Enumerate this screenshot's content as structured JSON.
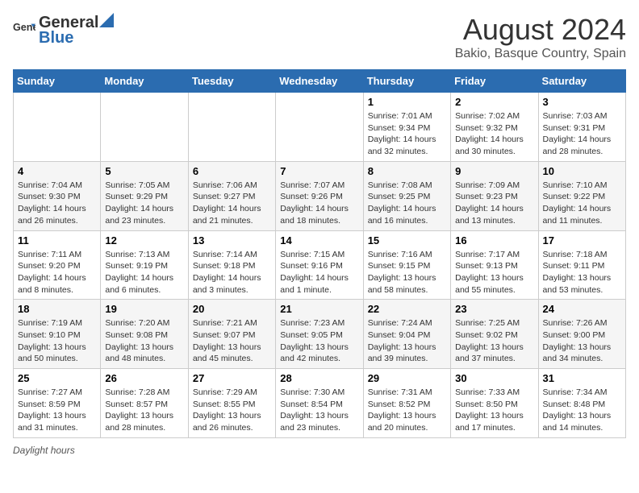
{
  "header": {
    "logo_general": "General",
    "logo_blue": "Blue",
    "title": "August 2024",
    "subtitle": "Bakio, Basque Country, Spain"
  },
  "weekdays": [
    "Sunday",
    "Monday",
    "Tuesday",
    "Wednesday",
    "Thursday",
    "Friday",
    "Saturday"
  ],
  "weeks": [
    [
      {
        "day": "",
        "info": ""
      },
      {
        "day": "",
        "info": ""
      },
      {
        "day": "",
        "info": ""
      },
      {
        "day": "",
        "info": ""
      },
      {
        "day": "1",
        "info": "Sunrise: 7:01 AM\nSunset: 9:34 PM\nDaylight: 14 hours\nand 32 minutes."
      },
      {
        "day": "2",
        "info": "Sunrise: 7:02 AM\nSunset: 9:32 PM\nDaylight: 14 hours\nand 30 minutes."
      },
      {
        "day": "3",
        "info": "Sunrise: 7:03 AM\nSunset: 9:31 PM\nDaylight: 14 hours\nand 28 minutes."
      }
    ],
    [
      {
        "day": "4",
        "info": "Sunrise: 7:04 AM\nSunset: 9:30 PM\nDaylight: 14 hours\nand 26 minutes."
      },
      {
        "day": "5",
        "info": "Sunrise: 7:05 AM\nSunset: 9:29 PM\nDaylight: 14 hours\nand 23 minutes."
      },
      {
        "day": "6",
        "info": "Sunrise: 7:06 AM\nSunset: 9:27 PM\nDaylight: 14 hours\nand 21 minutes."
      },
      {
        "day": "7",
        "info": "Sunrise: 7:07 AM\nSunset: 9:26 PM\nDaylight: 14 hours\nand 18 minutes."
      },
      {
        "day": "8",
        "info": "Sunrise: 7:08 AM\nSunset: 9:25 PM\nDaylight: 14 hours\nand 16 minutes."
      },
      {
        "day": "9",
        "info": "Sunrise: 7:09 AM\nSunset: 9:23 PM\nDaylight: 14 hours\nand 13 minutes."
      },
      {
        "day": "10",
        "info": "Sunrise: 7:10 AM\nSunset: 9:22 PM\nDaylight: 14 hours\nand 11 minutes."
      }
    ],
    [
      {
        "day": "11",
        "info": "Sunrise: 7:11 AM\nSunset: 9:20 PM\nDaylight: 14 hours\nand 8 minutes."
      },
      {
        "day": "12",
        "info": "Sunrise: 7:13 AM\nSunset: 9:19 PM\nDaylight: 14 hours\nand 6 minutes."
      },
      {
        "day": "13",
        "info": "Sunrise: 7:14 AM\nSunset: 9:18 PM\nDaylight: 14 hours\nand 3 minutes."
      },
      {
        "day": "14",
        "info": "Sunrise: 7:15 AM\nSunset: 9:16 PM\nDaylight: 14 hours\nand 1 minute."
      },
      {
        "day": "15",
        "info": "Sunrise: 7:16 AM\nSunset: 9:15 PM\nDaylight: 13 hours\nand 58 minutes."
      },
      {
        "day": "16",
        "info": "Sunrise: 7:17 AM\nSunset: 9:13 PM\nDaylight: 13 hours\nand 55 minutes."
      },
      {
        "day": "17",
        "info": "Sunrise: 7:18 AM\nSunset: 9:11 PM\nDaylight: 13 hours\nand 53 minutes."
      }
    ],
    [
      {
        "day": "18",
        "info": "Sunrise: 7:19 AM\nSunset: 9:10 PM\nDaylight: 13 hours\nand 50 minutes."
      },
      {
        "day": "19",
        "info": "Sunrise: 7:20 AM\nSunset: 9:08 PM\nDaylight: 13 hours\nand 48 minutes."
      },
      {
        "day": "20",
        "info": "Sunrise: 7:21 AM\nSunset: 9:07 PM\nDaylight: 13 hours\nand 45 minutes."
      },
      {
        "day": "21",
        "info": "Sunrise: 7:23 AM\nSunset: 9:05 PM\nDaylight: 13 hours\nand 42 minutes."
      },
      {
        "day": "22",
        "info": "Sunrise: 7:24 AM\nSunset: 9:04 PM\nDaylight: 13 hours\nand 39 minutes."
      },
      {
        "day": "23",
        "info": "Sunrise: 7:25 AM\nSunset: 9:02 PM\nDaylight: 13 hours\nand 37 minutes."
      },
      {
        "day": "24",
        "info": "Sunrise: 7:26 AM\nSunset: 9:00 PM\nDaylight: 13 hours\nand 34 minutes."
      }
    ],
    [
      {
        "day": "25",
        "info": "Sunrise: 7:27 AM\nSunset: 8:59 PM\nDaylight: 13 hours\nand 31 minutes."
      },
      {
        "day": "26",
        "info": "Sunrise: 7:28 AM\nSunset: 8:57 PM\nDaylight: 13 hours\nand 28 minutes."
      },
      {
        "day": "27",
        "info": "Sunrise: 7:29 AM\nSunset: 8:55 PM\nDaylight: 13 hours\nand 26 minutes."
      },
      {
        "day": "28",
        "info": "Sunrise: 7:30 AM\nSunset: 8:54 PM\nDaylight: 13 hours\nand 23 minutes."
      },
      {
        "day": "29",
        "info": "Sunrise: 7:31 AM\nSunset: 8:52 PM\nDaylight: 13 hours\nand 20 minutes."
      },
      {
        "day": "30",
        "info": "Sunrise: 7:33 AM\nSunset: 8:50 PM\nDaylight: 13 hours\nand 17 minutes."
      },
      {
        "day": "31",
        "info": "Sunrise: 7:34 AM\nSunset: 8:48 PM\nDaylight: 13 hours\nand 14 minutes."
      }
    ]
  ],
  "footer": {
    "daylight_label": "Daylight hours"
  }
}
